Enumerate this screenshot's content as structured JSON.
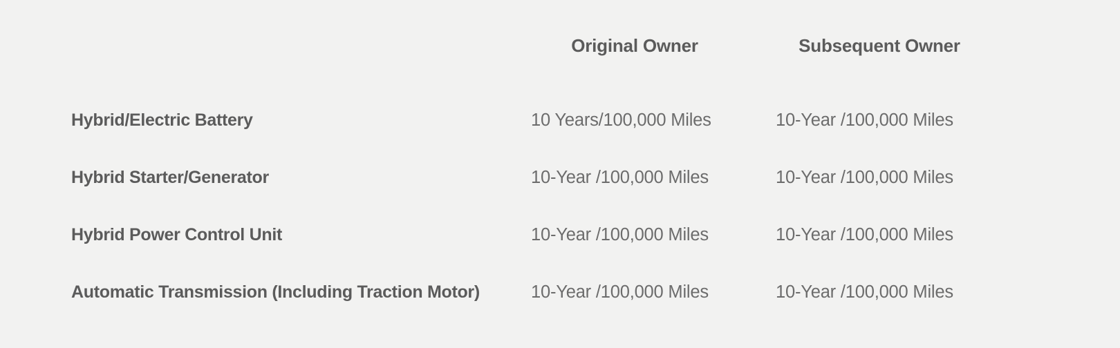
{
  "table": {
    "columns": [
      {
        "key": "feature",
        "label": ""
      },
      {
        "key": "original_owner",
        "label": "Original Owner"
      },
      {
        "key": "subsequent_owner",
        "label": "Subsequent Owner"
      }
    ],
    "rows": [
      {
        "feature": "Hybrid/Electric Battery",
        "original_owner": "10 Years/100,000 Miles",
        "subsequent_owner": "10-Year /100,000 Miles"
      },
      {
        "feature": "Hybrid Starter/Generator",
        "original_owner": "10-Year /100,000 Miles",
        "subsequent_owner": "10-Year /100,000 Miles"
      },
      {
        "feature": "Hybrid Power Control Unit",
        "original_owner": "10-Year /100,000 Miles",
        "subsequent_owner": "10-Year /100,000 Miles"
      },
      {
        "feature": "Automatic Transmission (Including Traction Motor)",
        "original_owner": "10-Year /100,000 Miles",
        "subsequent_owner": "10-Year /100,000 Miles"
      }
    ]
  },
  "colors": {
    "background": "#f2f2f1",
    "heading_text": "#5b5b5b",
    "value_text": "#6c6c6c"
  }
}
